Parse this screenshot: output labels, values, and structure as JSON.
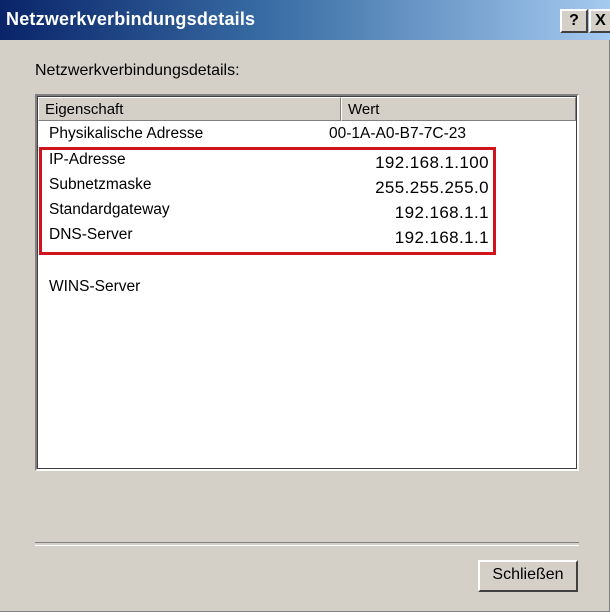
{
  "window": {
    "title": "Netzwerkverbindungsdetails",
    "help_button": "?",
    "close_button": "X"
  },
  "section_label": "Netzwerkverbindungsdetails:",
  "columns": {
    "property": "Eigenschaft",
    "value": "Wert"
  },
  "rows": [
    {
      "property": "Physikalische Adresse",
      "value": "00-1A-A0-B7-7C-23"
    },
    {
      "property": "IP-Adresse",
      "value": "192.168.1.100"
    },
    {
      "property": "Subnetzmaske",
      "value": "255.255.255.0"
    },
    {
      "property": "Standardgateway",
      "value": "192.168.1.1"
    },
    {
      "property": "DNS-Server",
      "value": "192.168.1.1"
    },
    {
      "property": "WINS-Server",
      "value": ""
    }
  ],
  "footer": {
    "close_label": "Schließen"
  },
  "colors": {
    "highlight": "#d0141e",
    "titlebar_start": "#0a246a",
    "titlebar_end": "#a6caf0"
  }
}
